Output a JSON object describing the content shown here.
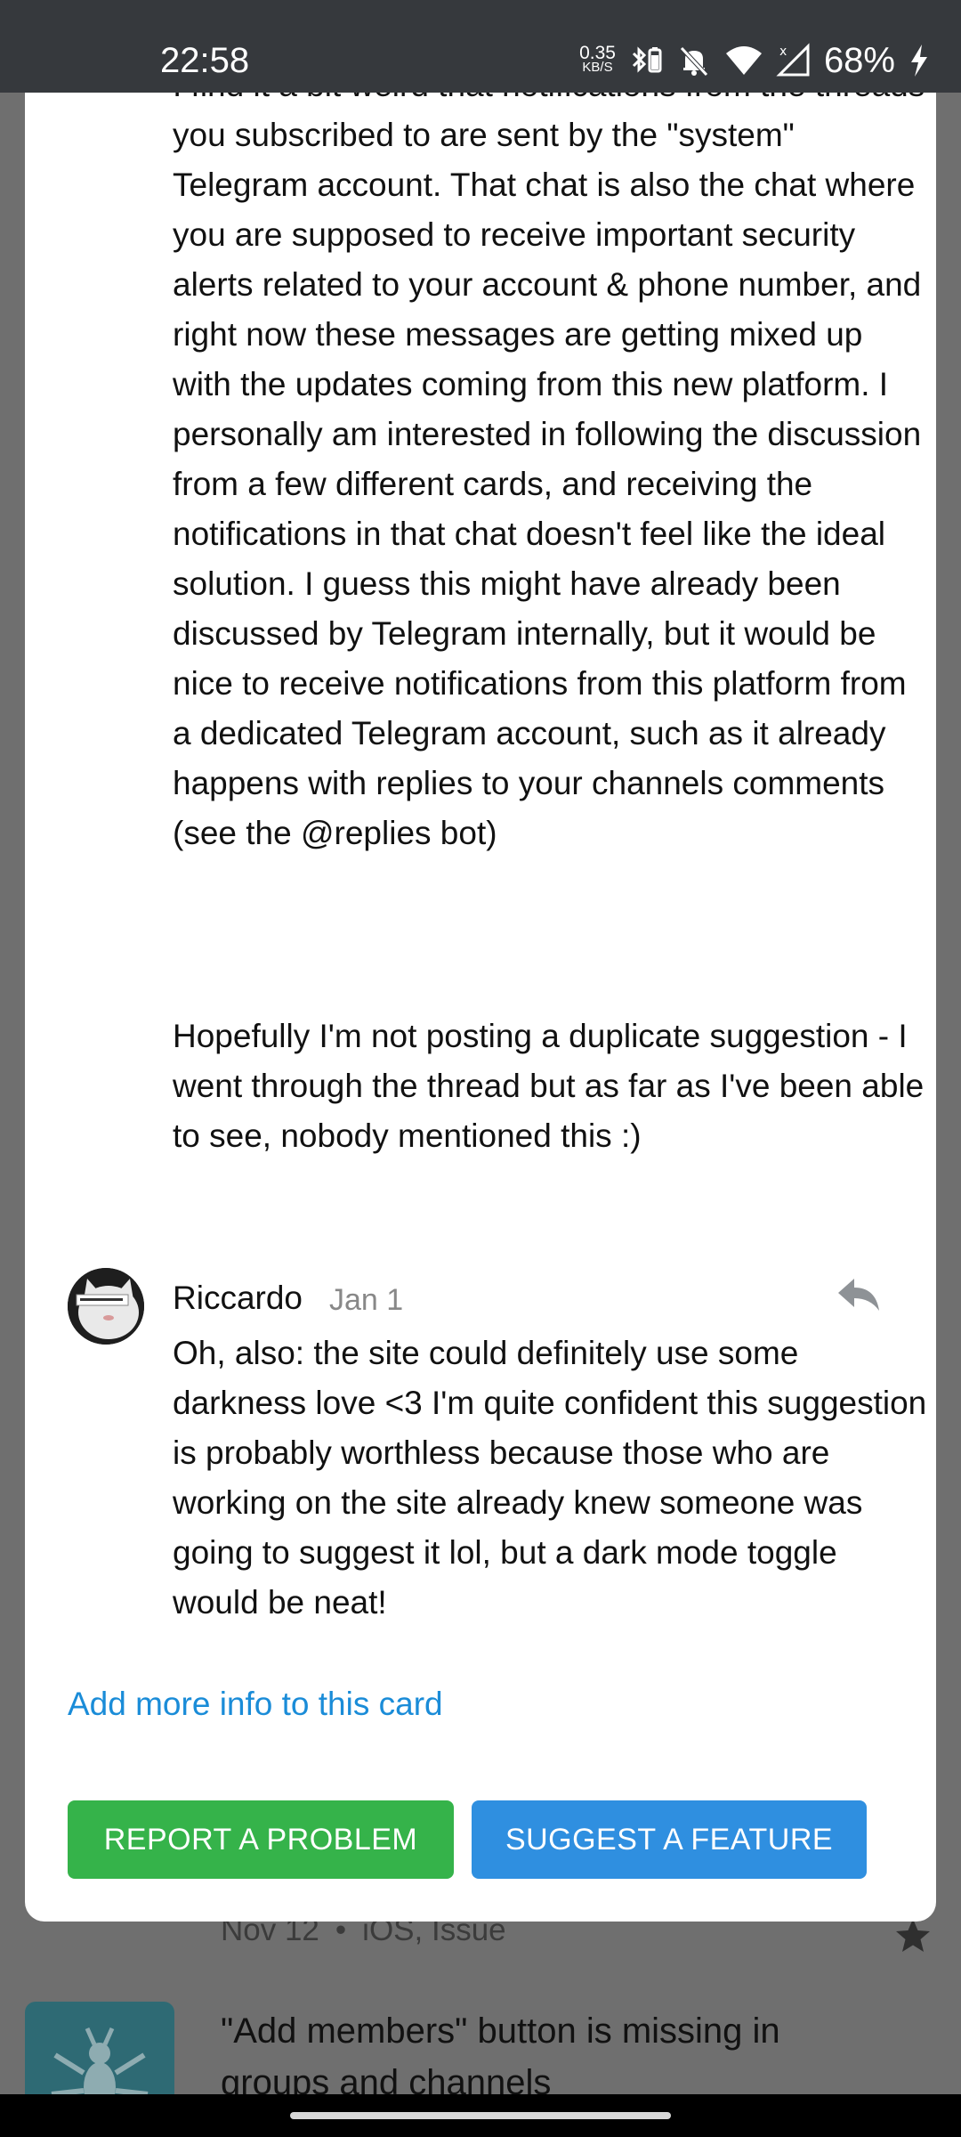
{
  "status_bar": {
    "time": "22:58",
    "net_speed_value": "0.35",
    "net_speed_unit": "KB/S",
    "battery": "68%",
    "icons": [
      "bluetooth-battery-icon",
      "bell-off-icon",
      "wifi-icon",
      "signal-icon",
      "charging-icon"
    ]
  },
  "comments": [
    {
      "text": "I find it a bit weird that notifications from the threads you subscribed to are sent by the \"system\" Telegram account. That chat is also the chat where you are supposed to receive important security alerts related to your account & phone number, and right now these messages are getting mixed up with the updates coming from this new platform. I personally am interested in following the discussion from a few different cards, and receiving the notifications in that chat doesn't feel like the ideal solution. I guess this might have already been discussed by Telegram internally, but it would be nice to receive notifications from this platform from a dedicated Telegram account, such as it already happens with replies to your channels comments (see the @replies bot)",
      "text2": "Hopefully I'm not posting a duplicate suggestion - I went through the thread but as far as I've been able to see, nobody mentioned this :)"
    },
    {
      "author": "Riccardo",
      "date": "Jan 1",
      "text": "Oh, also: the site could definitely use some darkness love <3 I'm quite confident this suggestion is probably worthless because those who are working on the site already knew someone was going to suggest it lol, but a dark mode toggle would be neat!"
    }
  ],
  "actions": {
    "add_info": "Add more info to this card",
    "report": "REPORT A PROBLEM",
    "suggest": "SUGGEST A FEATURE"
  },
  "background_card": {
    "date": "Nov 12",
    "tags": "iOS, Issue",
    "title": "\"Add members\" button is missing in groups and channels"
  },
  "colors": {
    "accent_link": "#1a8cd8",
    "report_button": "#35b34a",
    "suggest_button": "#2f8fe0",
    "status_bar": "#36393d"
  }
}
